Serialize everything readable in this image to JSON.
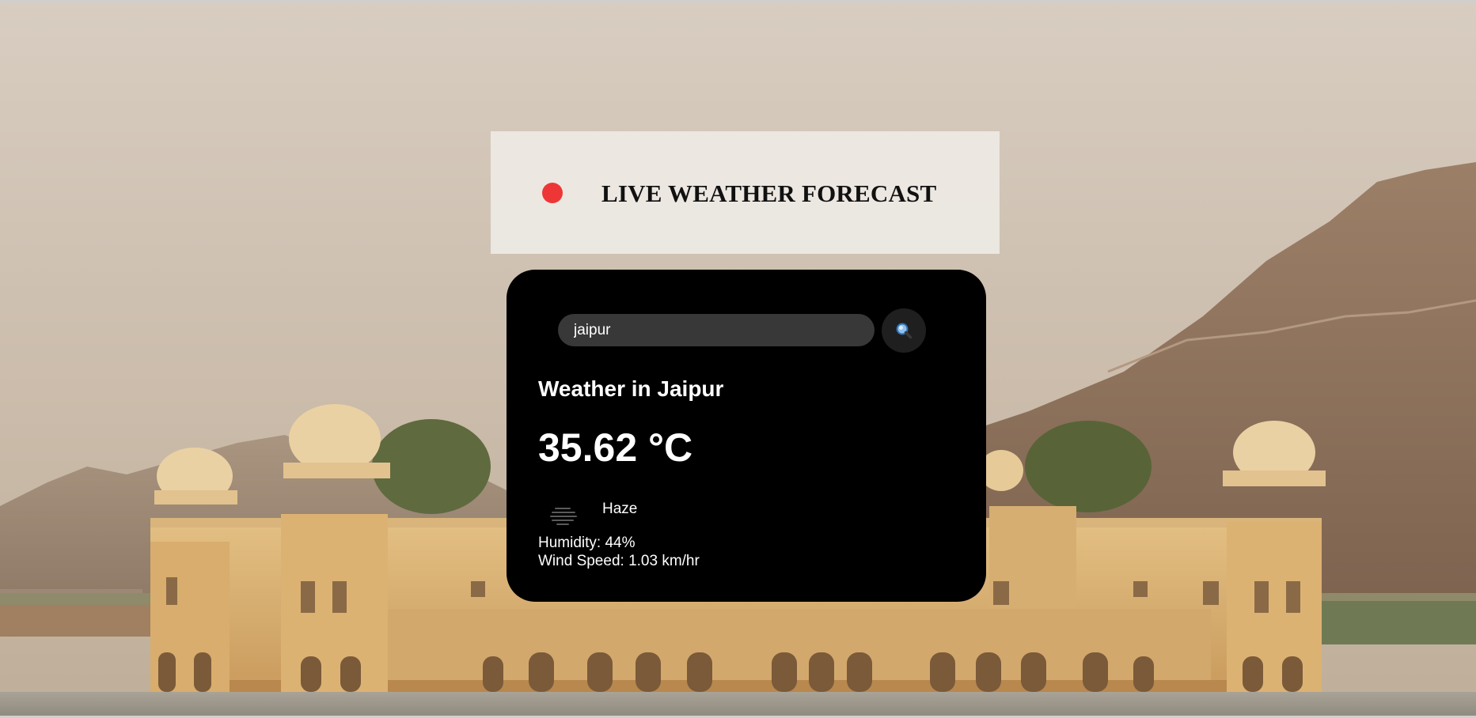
{
  "header": {
    "title": "LIVE WEATHER FORECAST",
    "live_indicator_color": "#ee3636"
  },
  "search": {
    "value": "jaipur",
    "placeholder": "",
    "button_icon": "search-icon"
  },
  "weather": {
    "heading": "Weather in Jaipur",
    "temperature": "35.62 °C",
    "condition_icon": "haze-icon",
    "condition": "Haze",
    "humidity": "Humidity: 44%",
    "wind_speed": "Wind Speed: 1.03 km/hr"
  },
  "colors": {
    "card_background": "#000000",
    "input_background": "#383838",
    "search_button_background": "#1f1f1f",
    "banner_background": "#ece8e3"
  }
}
